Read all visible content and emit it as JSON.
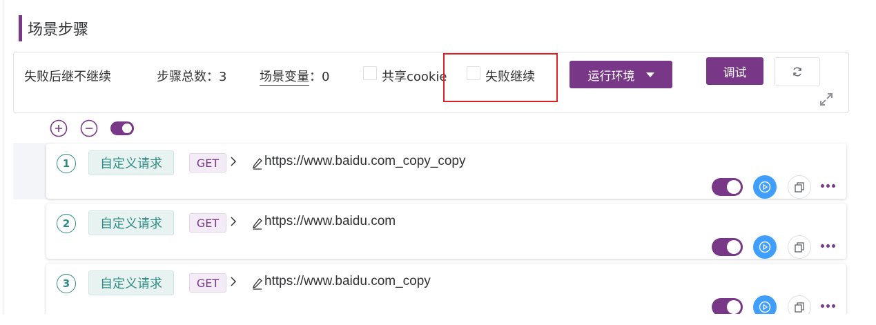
{
  "section_title": "场景步骤",
  "toolbar": {
    "fail_strategy": "失败后继不继续",
    "step_total_label": "步骤总数：",
    "step_total_value": "3",
    "scene_var_label": "场景变量",
    "scene_var_sep": "：",
    "scene_var_value": "0",
    "share_cookie_label": "共享cookie",
    "share_cookie_checked": false,
    "fail_continue_label": "失败继续",
    "fail_continue_checked": false,
    "env_button_label": "运行环境",
    "debug_button_label": "调试"
  },
  "steps": [
    {
      "index": "1",
      "type": "自定义请求",
      "method": "GET",
      "url": "https://www.baidu.com_copy_copy",
      "enabled": true
    },
    {
      "index": "2",
      "type": "自定义请求",
      "method": "GET",
      "url": "https://www.baidu.com",
      "enabled": true
    },
    {
      "index": "3",
      "type": "自定义请求",
      "method": "GET",
      "url": "https://www.baidu.com_copy",
      "enabled": true
    }
  ],
  "colors": {
    "accent": "#783887",
    "teal": "#2e8b84",
    "run_blue": "#409eff",
    "highlight_red": "#e02020"
  },
  "icons": {
    "expand_all": "plus-circle-icon",
    "collapse_all": "minus-circle-icon",
    "refresh": "refresh-icon",
    "fullscreen": "expand-arrows-icon",
    "run": "play-circle-icon",
    "copy": "copy-icon",
    "more": "more-dots-icon",
    "edit": "pencil-icon",
    "chevron": "chevron-right-icon"
  }
}
